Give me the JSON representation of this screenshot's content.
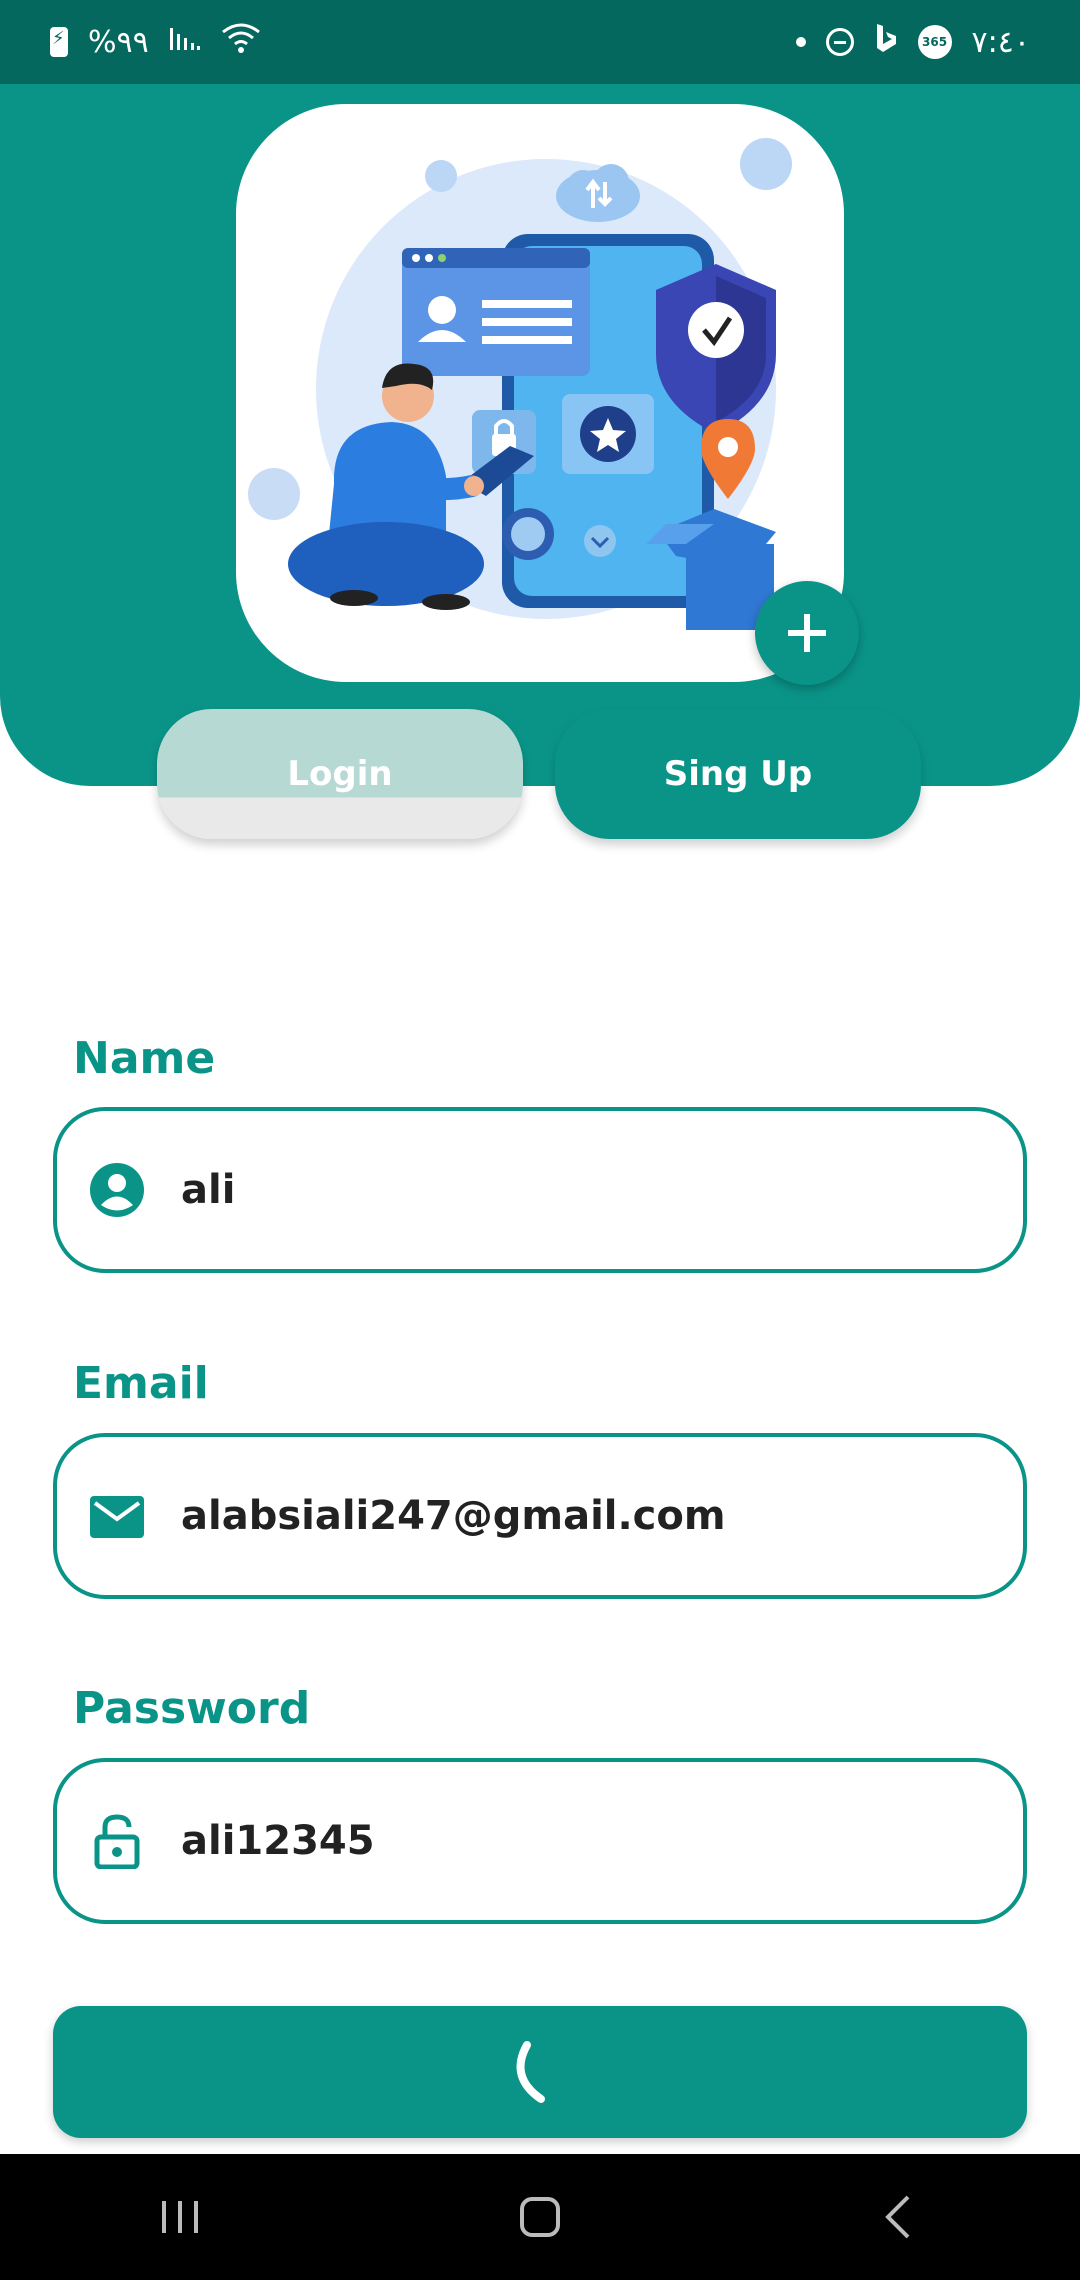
{
  "status_bar": {
    "battery_percent": "%٩٩",
    "time": "٧:٤٠",
    "badge_365": "365",
    "icons": [
      "battery-charging-icon",
      "signal-icon",
      "wifi-icon",
      "dot-icon",
      "do-not-disturb-icon",
      "bing-icon",
      "office-365-icon"
    ]
  },
  "header": {
    "illustration": "security-illustration",
    "add_button_icon": "plus-icon"
  },
  "tabs": [
    {
      "label": "Login",
      "active": false
    },
    {
      "label": "Sing Up",
      "active": true
    }
  ],
  "form": {
    "name": {
      "label": "Name",
      "value": "ali",
      "icon": "account-circle-icon"
    },
    "email": {
      "label": "Email",
      "value": "alabsiali247@gmail.com",
      "icon": "email-icon"
    },
    "password": {
      "label": "Password",
      "value": "ali12345",
      "icon": "lock-open-icon"
    }
  },
  "submit": {
    "icon": "loading-spinner-icon"
  },
  "nav_bar": {
    "icons": [
      "recent-apps-icon",
      "home-icon",
      "back-icon"
    ]
  },
  "colors": {
    "primary": "#0a9488",
    "status_bar": "#05685f",
    "login_tab": "#b7d9d4"
  }
}
